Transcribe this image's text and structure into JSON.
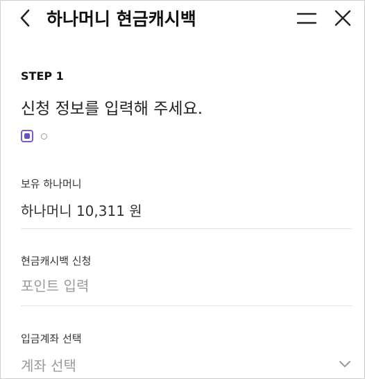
{
  "header": {
    "title": "하나머니 현금캐시백",
    "back_icon": "chevron-left-icon",
    "menu_icon": "hamburger-menu-icon",
    "close_icon": "close-icon"
  },
  "step": {
    "label": "STEP 1",
    "description": "신청 정보를 입력해 주세요.",
    "current": 1,
    "total": 2,
    "accent_color": "#6d4fbf"
  },
  "fields": {
    "balance": {
      "label": "보유 하나머니",
      "value": "하나머니 10,311 원"
    },
    "cashback": {
      "label": "현금캐시백 신청",
      "placeholder": "포인트 입력"
    },
    "account": {
      "label": "입금계좌 선택",
      "placeholder": "계좌 선택",
      "dropdown_icon": "chevron-down-icon"
    }
  }
}
